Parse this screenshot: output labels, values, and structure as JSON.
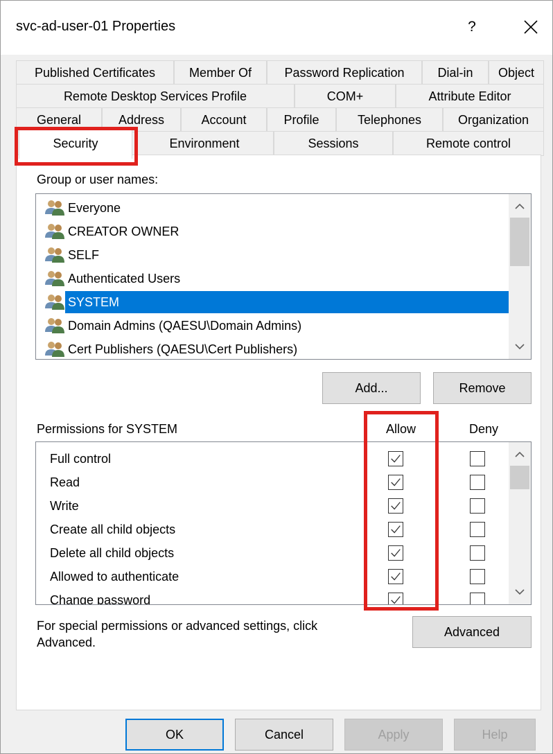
{
  "window": {
    "title": "svc-ad-user-01 Properties",
    "help_glyph": "?",
    "close_glyph": "✕"
  },
  "tabs": {
    "row1": [
      "Published Certificates",
      "Member Of",
      "Password Replication",
      "Dial-in",
      "Object"
    ],
    "row2": [
      "Remote Desktop Services Profile",
      "COM+",
      "Attribute Editor"
    ],
    "row3": [
      "General",
      "Address",
      "Account",
      "Profile",
      "Telephones",
      "Organization"
    ],
    "row4": [
      "Security",
      "Environment",
      "Sessions",
      "Remote control"
    ],
    "active": "Security"
  },
  "group_section": {
    "label": "Group or user names:",
    "items": [
      "Everyone",
      "CREATOR OWNER",
      "SELF",
      "Authenticated Users",
      "SYSTEM",
      "Domain Admins (QAESU\\Domain Admins)",
      "Cert Publishers (QAESU\\Cert Publishers)"
    ],
    "selected": "SYSTEM",
    "add_button": "Add...",
    "remove_button": "Remove"
  },
  "permissions": {
    "label": "Permissions for SYSTEM",
    "allow_header": "Allow",
    "deny_header": "Deny",
    "rows": [
      {
        "name": "Full control",
        "allow": true,
        "deny": false
      },
      {
        "name": "Read",
        "allow": true,
        "deny": false
      },
      {
        "name": "Write",
        "allow": true,
        "deny": false
      },
      {
        "name": "Create all child objects",
        "allow": true,
        "deny": false
      },
      {
        "name": "Delete all child objects",
        "allow": true,
        "deny": false
      },
      {
        "name": "Allowed to authenticate",
        "allow": true,
        "deny": false
      },
      {
        "name": "Change password",
        "allow": true,
        "deny": false
      }
    ]
  },
  "advanced": {
    "hint_line1": "For special permissions or advanced settings, click",
    "hint_line2": "Advanced.",
    "button": "Advanced"
  },
  "footer": {
    "ok": "OK",
    "cancel": "Cancel",
    "apply": "Apply",
    "help": "Help"
  },
  "colors": {
    "selection": "#0078d7",
    "annotation": "#e0211d",
    "dialog_bg": "#f0f0f0"
  }
}
